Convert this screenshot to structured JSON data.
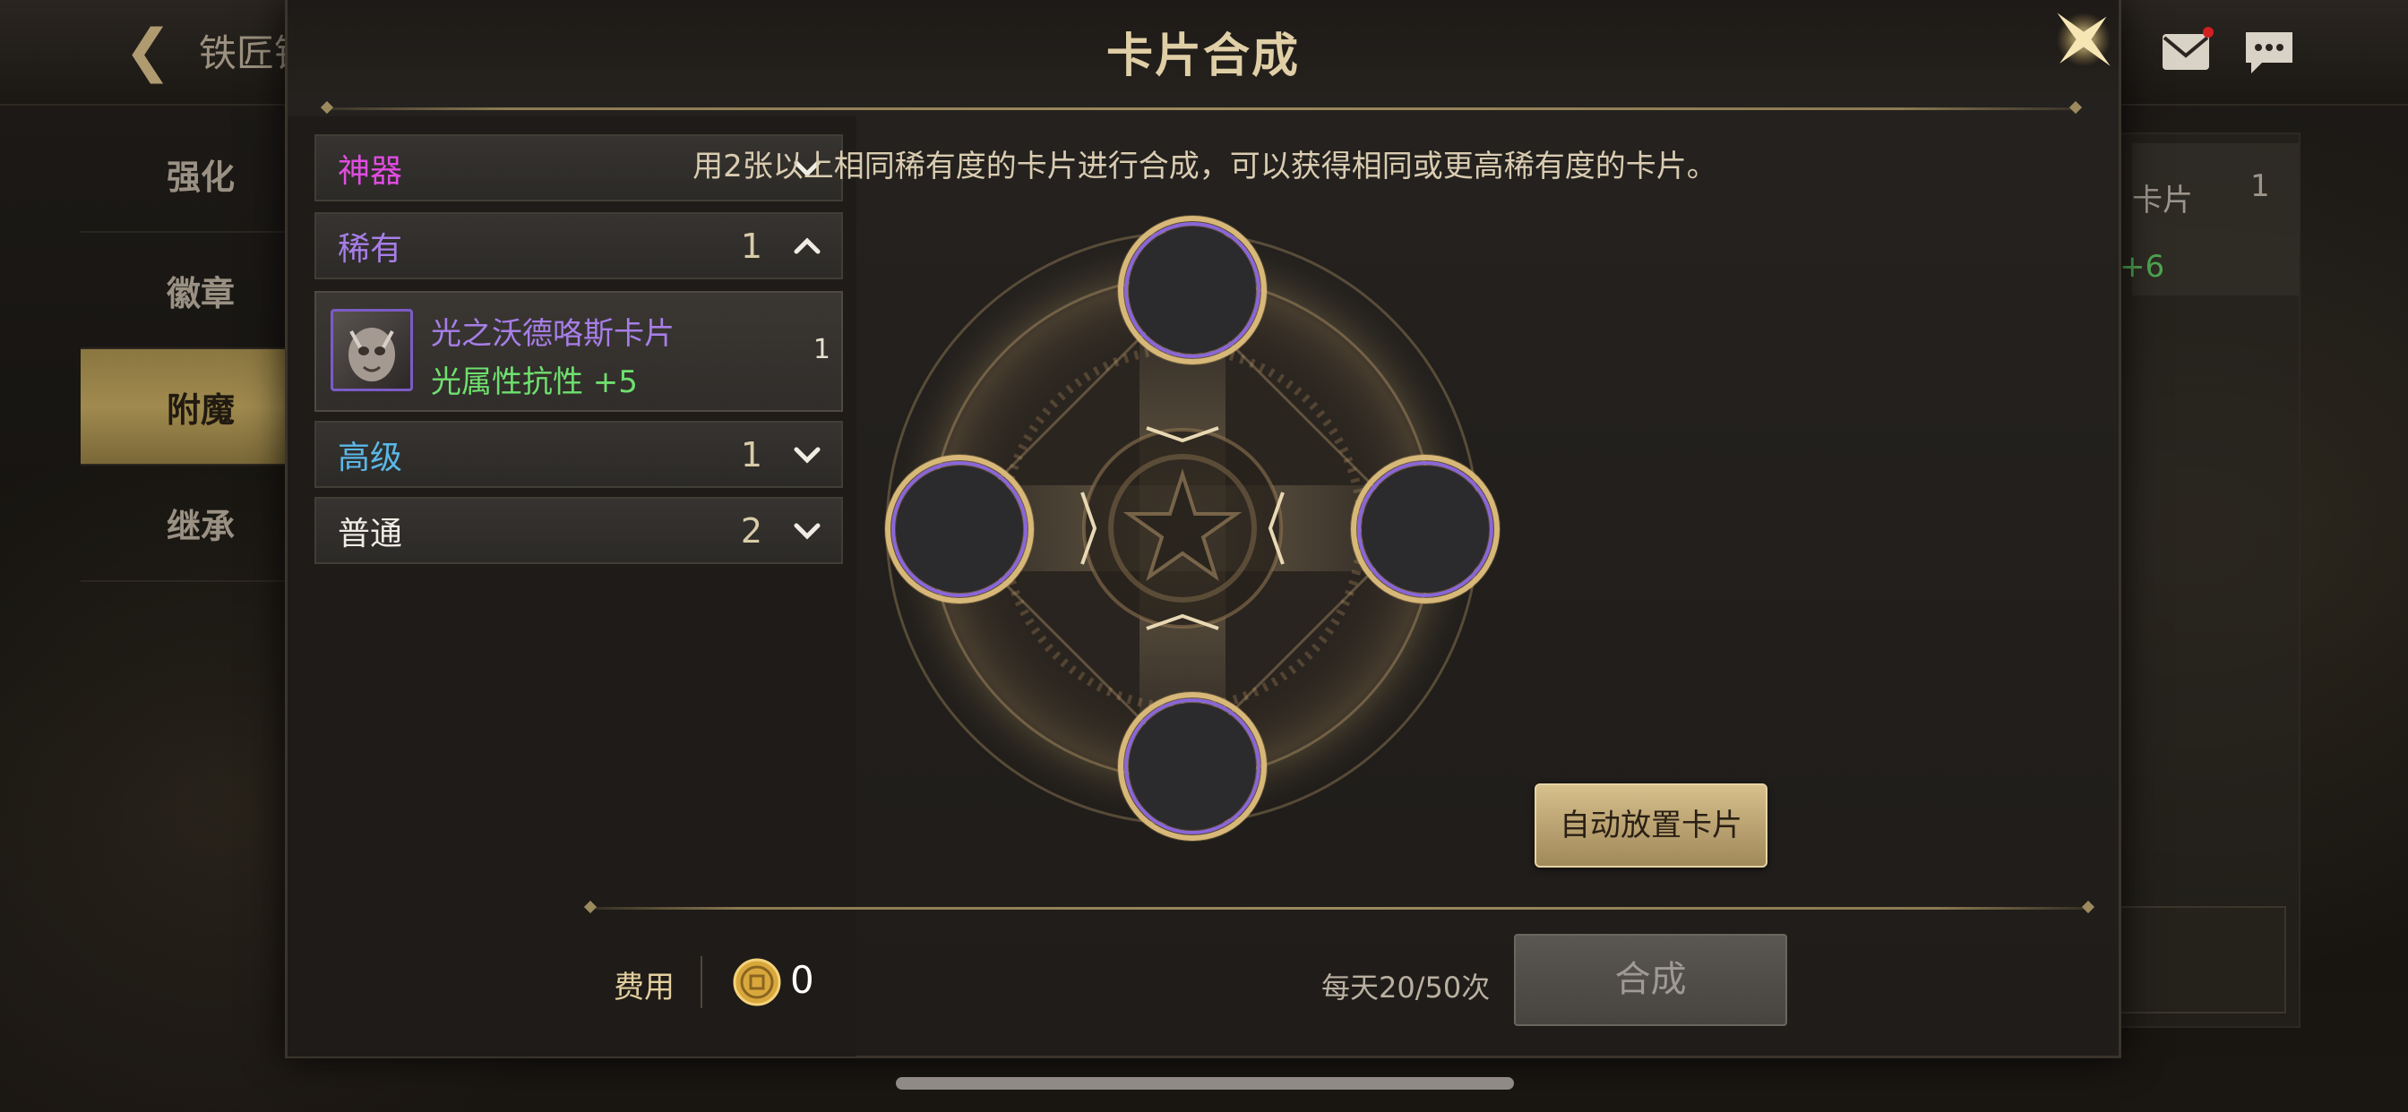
{
  "background": {
    "screen_title": "铁匠铺",
    "menu": [
      {
        "label": "强化"
      },
      {
        "label": "徽章"
      },
      {
        "label": "附魔"
      },
      {
        "label": "继承"
      }
    ],
    "right_panel": {
      "label": "卡片",
      "count": "1",
      "bonus": "+6"
    }
  },
  "dialog": {
    "title": "卡片合成",
    "description": "用2张以上相同稀有度的卡片进行合成，可以获得相同或更高稀有度的卡片。",
    "categories": [
      {
        "label": "神器",
        "count": "",
        "expanded": false,
        "color": "#e04ce0"
      },
      {
        "label": "稀有",
        "count": "1",
        "expanded": true,
        "color": "#a77ee8"
      },
      {
        "label": "高级",
        "count": "1",
        "expanded": false,
        "color": "#5ab8e8"
      },
      {
        "label": "普通",
        "count": "2",
        "expanded": false,
        "color": "#f0ece4"
      }
    ],
    "card": {
      "name": "光之沃德咯斯卡片",
      "attribute": "光属性抗性 +5",
      "quantity": "1"
    },
    "auto_place_label": "自动放置卡片",
    "cost_label": "费用",
    "cost_value": "0",
    "daily_count": "每天20/50次",
    "synthesize_label": "合成"
  },
  "colors": {
    "accent_gold": "#d7c08c",
    "rare_purple": "#a77ee8",
    "stat_green": "#6fe06e",
    "artifact_magenta": "#e04ce0",
    "advanced_blue": "#5ab8e8"
  }
}
